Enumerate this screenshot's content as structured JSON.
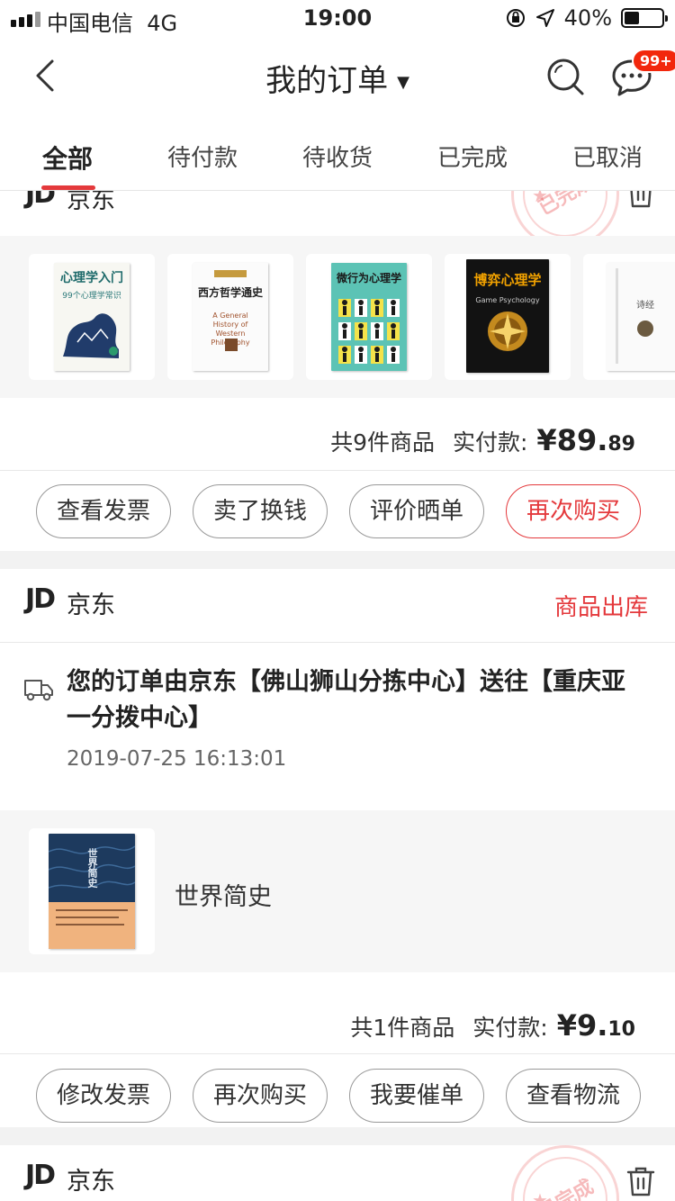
{
  "status_bar": {
    "carrier": "中国电信",
    "network": "4G",
    "time": "19:00",
    "battery": "40%",
    "battery_level": 0.4
  },
  "header": {
    "title": "我的订单",
    "message_badge": "99+"
  },
  "tabs": [
    {
      "label": "全部",
      "active": true
    },
    {
      "label": "待付款",
      "active": false
    },
    {
      "label": "待收货",
      "active": false
    },
    {
      "label": "已完成",
      "active": false
    },
    {
      "label": "已取消",
      "active": false
    }
  ],
  "orders": [
    {
      "shop_logo": "JD",
      "shop_name": "京东",
      "stamp": "已完成",
      "books": [
        {
          "title": "心理学入门",
          "subtitle": "99个心理学常识"
        },
        {
          "title": "西方哲学通史",
          "subtitle": "A General History of Western Philosophy"
        },
        {
          "title": "微行为心理学",
          "subtitle": ""
        },
        {
          "title": "博弈心理学",
          "subtitle": "Game Psychology"
        },
        {
          "title": "诗经",
          "subtitle": ""
        }
      ],
      "count_text": "共9件商品",
      "paid_label": "实付款:",
      "price_main": "¥89.",
      "price_cents": "89",
      "buttons": [
        "查看发票",
        "卖了换钱",
        "评价晒单",
        "再次购买"
      ]
    },
    {
      "shop_logo": "JD",
      "shop_name": "京东",
      "status": "商品出库",
      "tracking_text": "您的订单由京东【佛山狮山分拣中心】送往【重庆亚一分拨中心】",
      "tracking_time": "2019-07-25 16:13:01",
      "product_name": "世界简史",
      "count_text": "共1件商品",
      "paid_label": "实付款:",
      "price_main": "¥9.",
      "price_cents": "10",
      "buttons": [
        "修改发票",
        "再次购买",
        "我要催单",
        "查看物流"
      ]
    },
    {
      "shop_logo": "JD",
      "shop_name": "京东",
      "stamp": "已完成"
    }
  ]
}
